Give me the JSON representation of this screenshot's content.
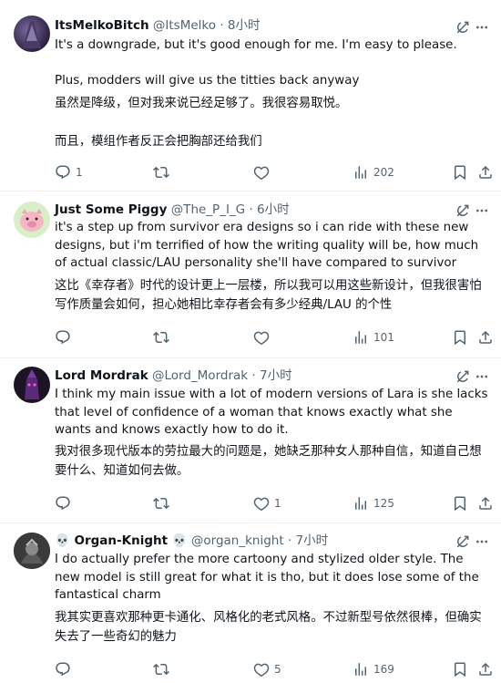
{
  "tweets": [
    {
      "name": "ItsMelkoBitch",
      "handle": "@ItsMelko",
      "time": "8小时",
      "text": "It's a downgrade, but it's good enough for me. I'm easy to please.\n\nPlus, modders will give us the titties back anyway",
      "translation": "虽然是降级，但对我来说已经足够了。我很容易取悦。\n\n而且，模组作者反正会把胸部还给我们",
      "replies": "1",
      "reposts": "",
      "likes": "",
      "views": "202"
    },
    {
      "name": "Just Some Piggy",
      "handle": "@The_P_I_G",
      "time": "6小时",
      "text": "it's a step up from survivor era designs so i can ride with these new designs, but i'm terrified of how the writing quality will be, how much of actual classic/LAU personality she'll have compared to survivor",
      "translation": "这比《幸存者》时代的设计更上一层楼，所以我可以用这些新设计，但我很害怕写作质量会如何，担心她相比幸存者会有多少经典/LAU 的个性",
      "replies": "",
      "reposts": "",
      "likes": "",
      "views": "101"
    },
    {
      "name": "Lord Mordrak",
      "handle": "@Lord_Mordrak",
      "time": "7小时",
      "text": "I think my main issue with a lot of modern versions of Lara is she lacks that level of confidence of a woman that knows exactly what she wants and knows exactly how to do it.",
      "translation": "我对很多现代版本的劳拉最大的问题是，她缺乏那种女人那种自信，知道自己想要什么、知道如何去做。",
      "replies": "",
      "reposts": "",
      "likes": "1",
      "views": "125"
    },
    {
      "name": "💀 Organ-Knight 💀",
      "handle": "@organ_knight",
      "time": "7小时",
      "text": "I do actually prefer the more cartoony and stylized older style. The new model is still great for what it is tho, but it does lose some of the fantastical charm",
      "translation": "我其实更喜欢那种更卡通化、风格化的老式风格。不过新型号依然很棒，但确实失去了一些奇幻的魅力",
      "replies": "",
      "reposts": "",
      "likes": "5",
      "views": "169"
    }
  ],
  "separator": "·",
  "icons": [
    "reply-icon",
    "repost-icon",
    "like-icon",
    "views-icon",
    "bookmark-icon",
    "share-icon",
    "grok-icon",
    "more-icon"
  ],
  "colors": {
    "text": "#0f1419",
    "secondary": "#536471",
    "divider": "#eff3f4"
  }
}
